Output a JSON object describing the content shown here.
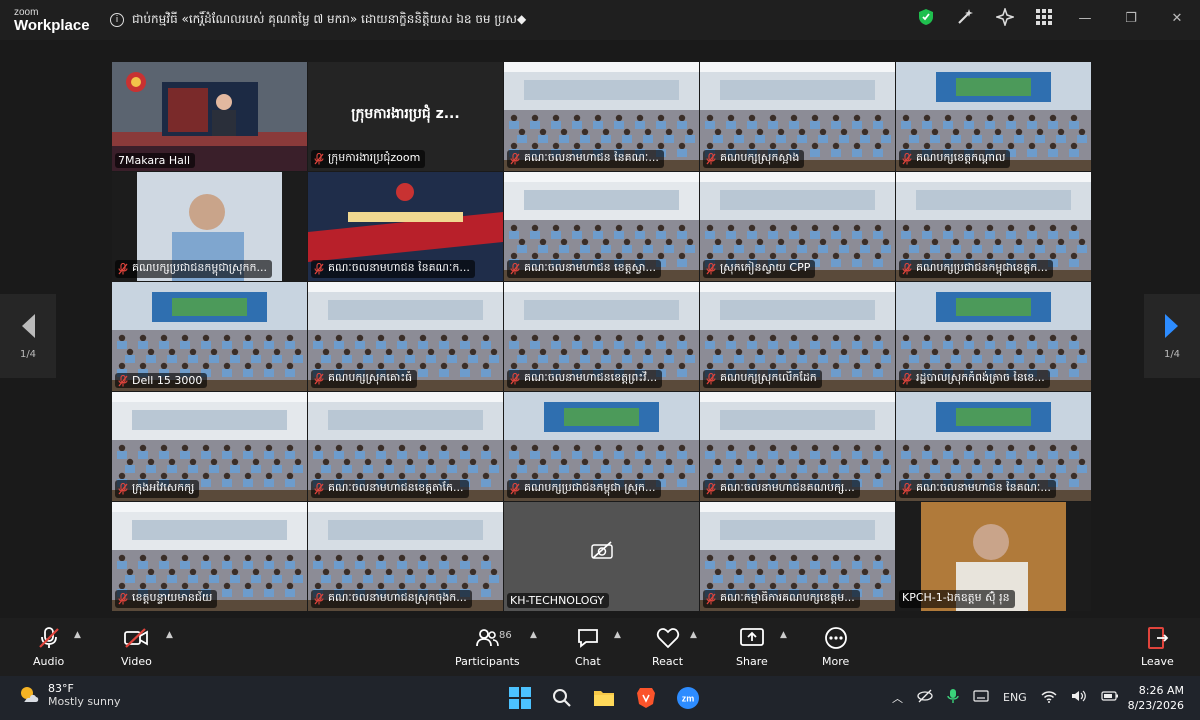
{
  "window": {
    "brand_top": "zoom",
    "brand_bottom": "Workplace",
    "meeting_title": "ជាប់កម្មវិធី «កេរ្តិ៍ដំណែលរបស់ គុណតម្លៃ ៧ មករា» ដោយនាក្ខិននិត្តិយស ឯឧ ចម ប្រស◆",
    "controls": [
      "—",
      "❐",
      "✕"
    ]
  },
  "pager": {
    "left_label": "1/4",
    "right_label": "1/4"
  },
  "participants": [
    {
      "name": "7Makara Hall",
      "muted": false,
      "scene": "hall",
      "active": true
    },
    {
      "name": "ក្រុមការងារប្រជុំzoom",
      "muted": true,
      "scene": "blank",
      "title": "ក្រុមការងារប្រជុំ z..."
    },
    {
      "name": "គណៈចលនាមហាជន នៃគណៈ...",
      "muted": true,
      "scene": "room"
    },
    {
      "name": "គណបក្សស្រុកស្អាង",
      "muted": true,
      "scene": "room"
    },
    {
      "name": "គណបក្សខេត្តកណ្តាល",
      "muted": true,
      "scene": "stage"
    },
    {
      "name": "គណបក្សប្រជាជនកម្ពុជាស្រុកក...",
      "muted": true,
      "scene": "person"
    },
    {
      "name": "គណៈចលនាមហាជន នៃគណៈក...",
      "muted": true,
      "scene": "banner"
    },
    {
      "name": "គណៈចលនាមហាជន ខេត្តស្វា...",
      "muted": true,
      "scene": "hall2"
    },
    {
      "name": "ស្រុកកៀនស្វាយ CPP",
      "muted": true,
      "scene": "room"
    },
    {
      "name": "គណបក្សប្រជាជនកម្ពុជាខេត្តក...",
      "muted": true,
      "scene": "room"
    },
    {
      "name": "Dell 15 3000",
      "muted": true,
      "scene": "stage"
    },
    {
      "name": "គណបក្សស្រុកគោះធំ",
      "muted": true,
      "scene": "room"
    },
    {
      "name": "គណៈចលនាមហាជនខេត្តព្រះវិ...",
      "muted": true,
      "scene": "room"
    },
    {
      "name": "គណបក្សស្រុកលើកដែក",
      "muted": true,
      "scene": "room"
    },
    {
      "name": "រដ្ឋបាលស្រុកកំពង់ត្រាច នៃខេ...",
      "muted": true,
      "scene": "stage"
    },
    {
      "name": "ក្រុងអវៃសេកក្ស",
      "muted": true,
      "scene": "hall2"
    },
    {
      "name": "គណៈចលនាមហាជនខេត្តតាកែ...",
      "muted": true,
      "scene": "room"
    },
    {
      "name": "គណបក្សប្រជាជនកម្ពុជា ស្រុក...",
      "muted": true,
      "scene": "stage"
    },
    {
      "name": "គណៈចលនាមហាជនគណបក្ស...",
      "muted": true,
      "scene": "room"
    },
    {
      "name": "គណៈចលនាមហាជន នៃគណៈ...",
      "muted": true,
      "scene": "stage"
    },
    {
      "name": "ខេត្តបន្ទាយមានជ័យ",
      "muted": true,
      "scene": "hall2"
    },
    {
      "name": "គណៈចលនាមហាជនស្រុកចុងក...",
      "muted": true,
      "scene": "room"
    },
    {
      "name": "KH-TECHNOLOGY",
      "muted": false,
      "scene": "camoff"
    },
    {
      "name": "គណៈកម្មាធិការគណបក្សខេត្តម...",
      "muted": true,
      "scene": "room"
    },
    {
      "name": "KPCH-1-ឯកឧត្តម ស៊ុំ រុន",
      "muted": false,
      "scene": "person2"
    }
  ],
  "toolbar": {
    "audio": "Audio",
    "video": "Video",
    "participants": "Participants",
    "participants_count": "86",
    "chat": "Chat",
    "react": "React",
    "share": "Share",
    "more": "More",
    "leave": "Leave"
  },
  "taskbar": {
    "temperature": "83°F",
    "condition": "Mostly sunny",
    "language": "ENG",
    "time": "8:26 AM",
    "date": "8/23/2026"
  },
  "colors": {
    "active_border": "#3ad37a",
    "leave_red": "#e0443c",
    "share_green": "#1fa35a"
  }
}
